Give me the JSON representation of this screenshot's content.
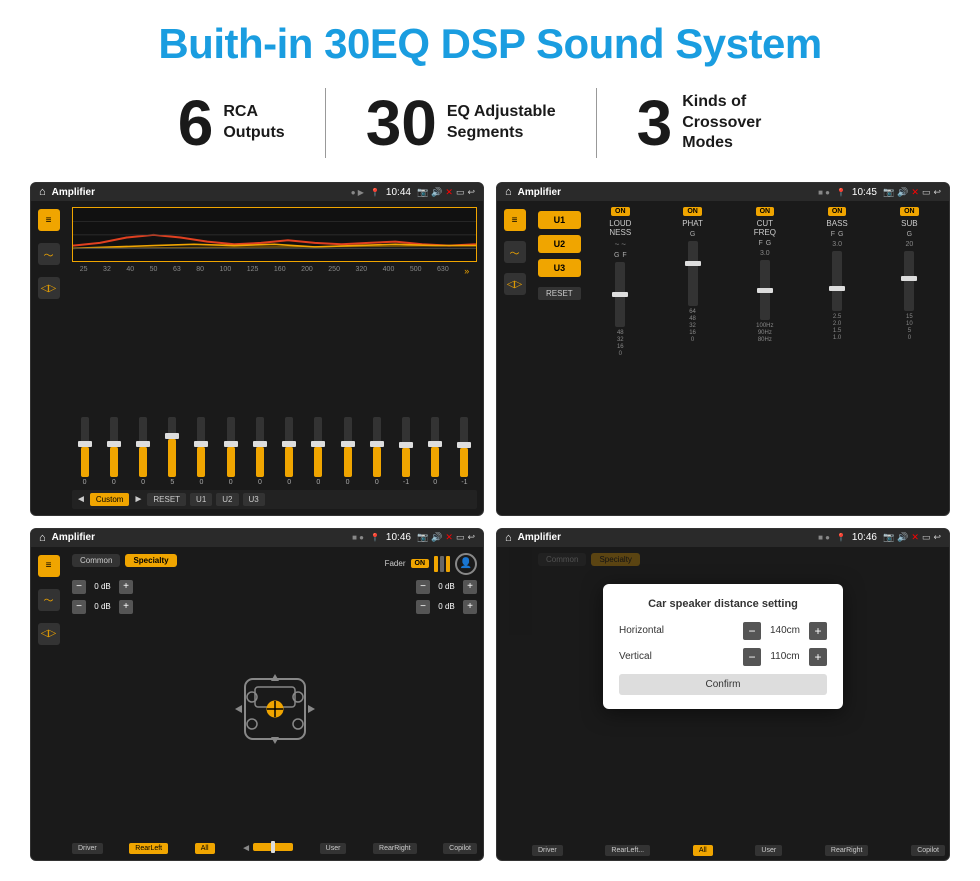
{
  "page": {
    "main_title": "Buith-in 30EQ DSP Sound System",
    "stats": [
      {
        "number": "6",
        "label": "RCA\nOutputs"
      },
      {
        "number": "30",
        "label": "EQ Adjustable\nSegments"
      },
      {
        "number": "3",
        "label": "Kinds of\nCrossover Modes"
      }
    ],
    "screens": [
      {
        "id": "screen1",
        "app_name": "Amplifier",
        "time": "10:44",
        "type": "eq",
        "freq_labels": [
          "25",
          "32",
          "40",
          "50",
          "63",
          "80",
          "100",
          "125",
          "160",
          "200",
          "250",
          "320",
          "400",
          "500",
          "630"
        ],
        "values": [
          "0",
          "0",
          "0",
          "5",
          "0",
          "0",
          "0",
          "0",
          "0",
          "0",
          "0",
          "-1",
          "0",
          "-1"
        ],
        "presets": [
          "Custom",
          "RESET",
          "U1",
          "U2",
          "U3"
        ]
      },
      {
        "id": "screen2",
        "app_name": "Amplifier",
        "time": "10:45",
        "type": "crossover",
        "presets": [
          "U1",
          "U2",
          "U3"
        ],
        "channels": [
          "LOUDNESS",
          "PHAT",
          "CUT FREQ",
          "BASS",
          "SUB"
        ],
        "reset": "RESET"
      },
      {
        "id": "screen3",
        "app_name": "Amplifier",
        "time": "10:46",
        "type": "fader",
        "tabs": [
          "Common",
          "Specialty"
        ],
        "fader_label": "Fader",
        "on_label": "ON",
        "db_values": [
          "0 dB",
          "0 dB",
          "0 dB",
          "0 dB"
        ],
        "bottom_btns": [
          "Driver",
          "RearLeft",
          "All",
          "User",
          "RearRight",
          "Copilot"
        ]
      },
      {
        "id": "screen4",
        "app_name": "Amplifier",
        "time": "10:46",
        "type": "distance",
        "tabs": [
          "Common",
          "Specialty"
        ],
        "dialog_title": "Car speaker distance setting",
        "horizontal_label": "Horizontal",
        "horizontal_value": "140cm",
        "vertical_label": "Vertical",
        "vertical_value": "110cm",
        "confirm_label": "Confirm",
        "bottom_btns": [
          "Driver",
          "RearLeft",
          "All",
          "User",
          "RearRight",
          "Copilot"
        ]
      }
    ]
  }
}
